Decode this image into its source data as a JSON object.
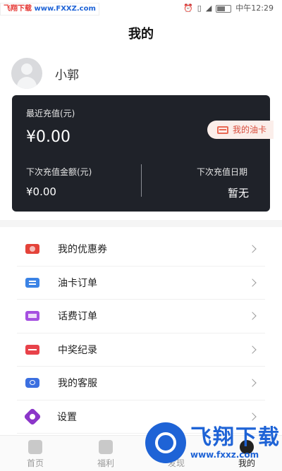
{
  "status_bar": {
    "watermark_left_a": "飞翔下载",
    "watermark_left_b": "www.FXXZ.com",
    "carrier": "中午12:29",
    "icons": [
      "alarm-icon",
      "vibrate-icon",
      "signal-icon",
      "battery-icon"
    ]
  },
  "header": {
    "title": "我的"
  },
  "user": {
    "name": "小郭"
  },
  "card": {
    "recent_label": "最近充值(元)",
    "recent_amount": "¥0.00",
    "oil_card_label": "我的油卡",
    "next_amount_label": "下次充值金额(元)",
    "next_amount": "¥0.00",
    "next_date_label": "下次充值日期",
    "next_date": "暂无"
  },
  "menu": [
    {
      "label": "我的优惠券",
      "icon": "coupon-icon"
    },
    {
      "label": "油卡订单",
      "icon": "oil-order-icon"
    },
    {
      "label": "话费订单",
      "icon": "phone-bill-icon"
    },
    {
      "label": "中奖纪录",
      "icon": "prize-icon"
    },
    {
      "label": "我的客服",
      "icon": "service-icon"
    },
    {
      "label": "设置",
      "icon": "settings-icon"
    }
  ],
  "tabs": [
    {
      "label": "首页",
      "icon": "home-icon"
    },
    {
      "label": "福利",
      "icon": "gift-icon"
    },
    {
      "label": "发现",
      "icon": "discover-icon"
    },
    {
      "label": "我的",
      "icon": "profile-icon",
      "active": true
    }
  ],
  "watermark_bottom": {
    "title": "飞翔下载",
    "url": "www.fxxz.com"
  },
  "colors": {
    "card_bg": "#1f2229",
    "accent_red": "#d84b3a",
    "brand_blue": "#1e63d6"
  }
}
